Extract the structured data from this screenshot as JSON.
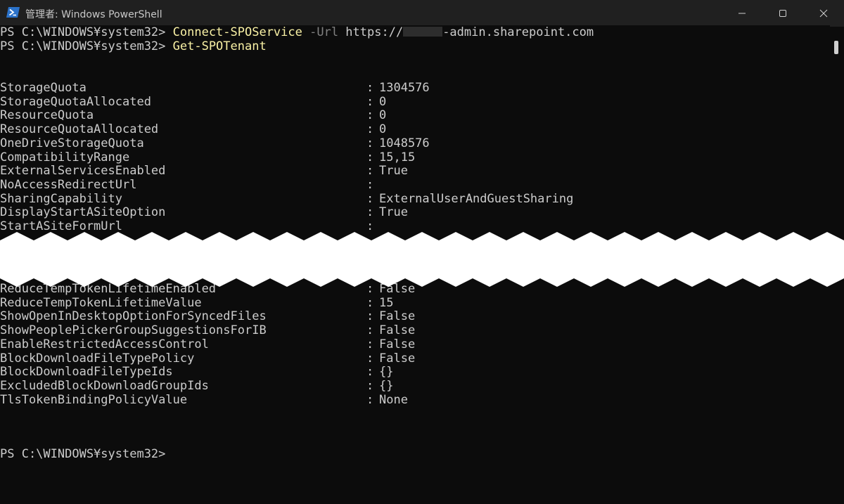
{
  "window": {
    "title": "管理者: Windows PowerShell",
    "icon": "powershell-icon"
  },
  "console": {
    "commands": [
      {
        "prompt": "PS C:\\WINDOWS¥system32> ",
        "cmd": "Connect-SPOService",
        "param": " -Url",
        "arg_prefix": " https://",
        "arg_suffix": "-admin.sharepoint.com"
      },
      {
        "prompt": "PS C:\\WINDOWS¥system32> ",
        "cmd": "Get-SPOTenant"
      }
    ],
    "separator": ":",
    "properties_top": [
      {
        "name": "StorageQuota",
        "value": "1304576"
      },
      {
        "name": "StorageQuotaAllocated",
        "value": "0"
      },
      {
        "name": "ResourceQuota",
        "value": "0"
      },
      {
        "name": "ResourceQuotaAllocated",
        "value": "0"
      },
      {
        "name": "OneDriveStorageQuota",
        "value": "1048576"
      },
      {
        "name": "CompatibilityRange",
        "value": "15,15"
      },
      {
        "name": "ExternalServicesEnabled",
        "value": "True"
      },
      {
        "name": "NoAccessRedirectUrl",
        "value": ""
      },
      {
        "name": "SharingCapability",
        "value": "ExternalUserAndGuestSharing"
      },
      {
        "name": "DisplayStartASiteOption",
        "value": "True"
      },
      {
        "name": "StartASiteFormUrl",
        "value": ""
      }
    ],
    "properties_bottom": [
      {
        "name": "ReduceTempTokenLifetimeEnabled",
        "value": "False"
      },
      {
        "name": "ReduceTempTokenLifetimeValue",
        "value": "15"
      },
      {
        "name": "ShowOpenInDesktopOptionForSyncedFiles",
        "value": "False"
      },
      {
        "name": "ShowPeoplePickerGroupSuggestionsForIB",
        "value": "False"
      },
      {
        "name": "EnableRestrictedAccessControl",
        "value": "False"
      },
      {
        "name": "BlockDownloadFileTypePolicy",
        "value": "False"
      },
      {
        "name": "BlockDownloadFileTypeIds",
        "value": "{}"
      },
      {
        "name": "ExcludedBlockDownloadGroupIds",
        "value": "{}"
      },
      {
        "name": "TlsTokenBindingPolicyValue",
        "value": "None"
      }
    ],
    "final_prompt": "PS C:\\WINDOWS¥system32>"
  }
}
